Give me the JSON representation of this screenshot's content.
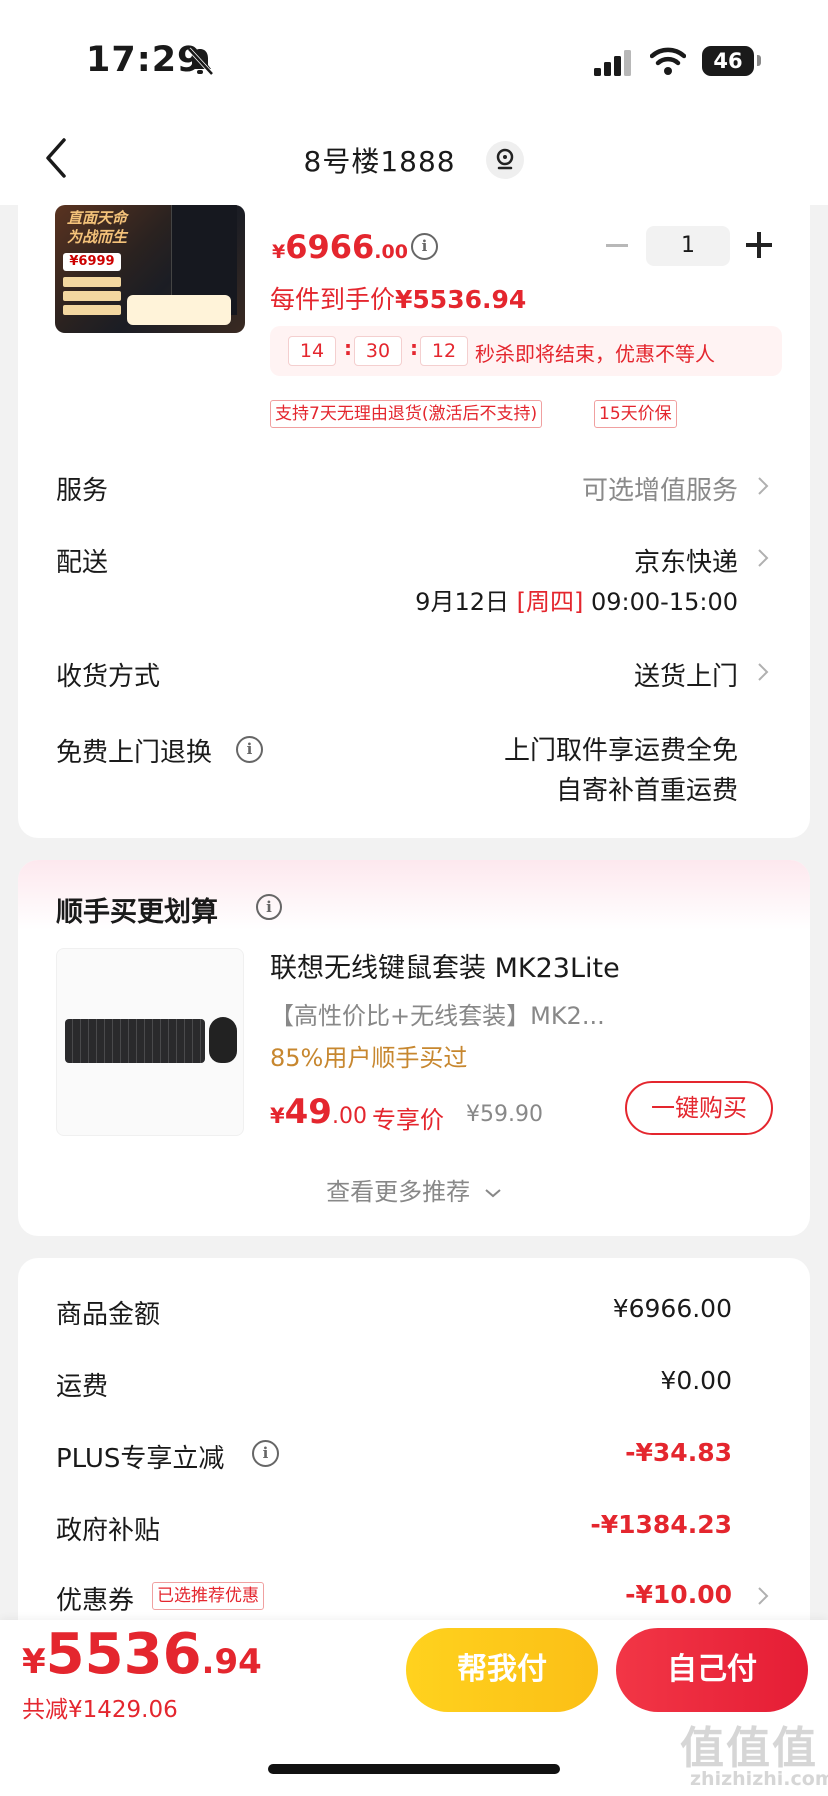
{
  "status_bar": {
    "time": "17:29",
    "battery": "46"
  },
  "header": {
    "title": "8号楼1888"
  },
  "product": {
    "image_caption": "直面天命 为战而生",
    "image_price": "¥6999",
    "price_currency": "¥",
    "price_int": "6966",
    "price_dec": ".00",
    "quantity": "1",
    "per_item_label": "每件到手价",
    "per_item_price": "¥5536.94",
    "countdown": {
      "h": "14",
      "m": "30",
      "s": "12",
      "text": "秒杀即将结束，优惠不等人"
    },
    "tags": [
      "支持7天无理由退货(激活后不支持)",
      "15天价保"
    ]
  },
  "rows": {
    "service_label": "服务",
    "service_value": "可选增值服务",
    "delivery_label": "配送",
    "delivery_value": "京东快递",
    "delivery_date": "9月12日",
    "delivery_weekday": "[周四]",
    "delivery_time": "09:00-15:00",
    "receive_label": "收货方式",
    "receive_value": "送货上门",
    "return_label": "免费上门退换",
    "return_line1": "上门取件享运费全免",
    "return_line2": "自寄补首重运费"
  },
  "addon": {
    "title": "顺手买更划算",
    "name": "联想无线键鼠套装 MK23Lite",
    "desc": "【高性价比+无线套装】MK2...",
    "bought": "85%用户顺手买过",
    "price_currency": "¥",
    "price_int": "49",
    "price_dec": ".00",
    "exclusive": "专享价",
    "orig_price": "¥59.90",
    "buy_button": "一键购买",
    "more": "查看更多推荐"
  },
  "summary": {
    "goods_label": "商品金额",
    "goods_value": "¥6966.00",
    "shipping_label": "运费",
    "shipping_value": "¥0.00",
    "plus_label": "PLUS专享立减",
    "plus_value": "-¥34.83",
    "subsidy_label": "政府补贴",
    "subsidy_value": "-¥1384.23",
    "coupon_label": "优惠券",
    "coupon_tag": "已选推荐优惠",
    "coupon_value": "-¥10.00"
  },
  "footer": {
    "total_currency": "¥",
    "total_int": "5536",
    "total_dec": ".94",
    "saved": "共减¥1429.06",
    "help_pay": "帮我付",
    "self_pay": "自己付"
  },
  "watermark": {
    "line1": "值值值",
    "line2": "zhizhizhi.com"
  },
  "colors": {
    "accent_red": "#e4262e",
    "yellow": "#fbbf16"
  }
}
